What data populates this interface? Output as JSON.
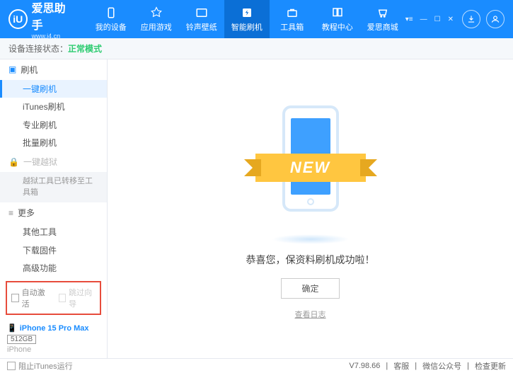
{
  "app": {
    "name": "爱思助手",
    "url": "www.i4.cn",
    "logo_letter": "iU"
  },
  "nav": [
    {
      "label": "我的设备"
    },
    {
      "label": "应用游戏"
    },
    {
      "label": "铃声壁纸"
    },
    {
      "label": "智能刷机"
    },
    {
      "label": "工具箱"
    },
    {
      "label": "教程中心"
    },
    {
      "label": "爱思商城"
    }
  ],
  "status": {
    "label": "设备连接状态：",
    "mode": "正常模式"
  },
  "sidebar": {
    "flash": {
      "title": "刷机",
      "items": [
        "一键刷机",
        "iTunes刷机",
        "专业刷机",
        "批量刷机"
      ]
    },
    "jailbreak": {
      "title": "一键越狱",
      "note": "越狱工具已转移至工具箱"
    },
    "more": {
      "title": "更多",
      "items": [
        "其他工具",
        "下载固件",
        "高级功能"
      ]
    }
  },
  "checkboxes": {
    "auto_activate": "自动激活",
    "skip_guide": "跳过向导"
  },
  "device": {
    "name": "iPhone 15 Pro Max",
    "storage": "512GB",
    "type": "iPhone"
  },
  "main": {
    "banner": "NEW",
    "success": "恭喜您，保资料刷机成功啦！",
    "ok": "确定",
    "log": "查看日志"
  },
  "footer": {
    "block_itunes": "阻止iTunes运行",
    "version": "V7.98.66",
    "support": "客服",
    "wechat": "微信公众号",
    "update": "检查更新"
  }
}
